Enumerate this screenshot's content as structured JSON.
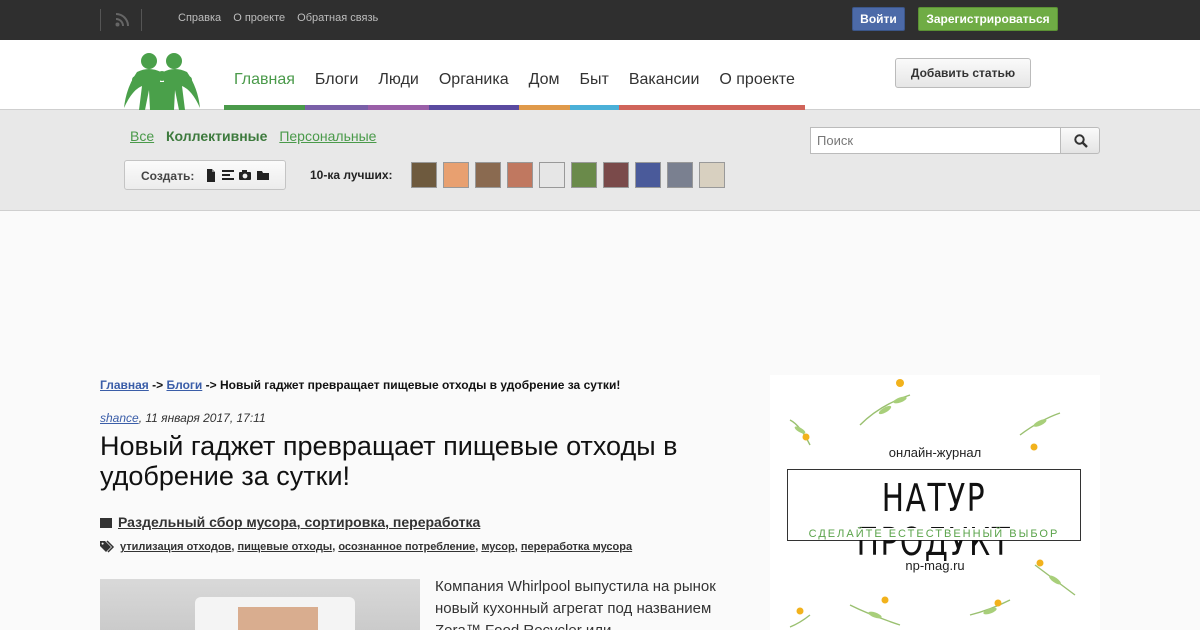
{
  "topbar": {
    "links": [
      "Справка",
      "О проекте",
      "Обратная связь"
    ],
    "login_label": "Войти",
    "register_label": "Зарегистрироваться"
  },
  "header": {
    "nav": [
      {
        "label": "Главная",
        "active": true,
        "color": "#4a9a4a"
      },
      {
        "label": "Блоги",
        "active": false,
        "color": "#7a60a8"
      },
      {
        "label": "Люди",
        "active": false,
        "color": "#9a5fa8"
      },
      {
        "label": "Органика",
        "active": false,
        "color": "#5a4aa0"
      },
      {
        "label": "Дом",
        "active": false,
        "color": "#e09a4a"
      },
      {
        "label": "Быт",
        "active": false,
        "color": "#4ab0d8"
      },
      {
        "label": "Вакансии",
        "active": false,
        "color": "#d0645a"
      },
      {
        "label": "О проекте",
        "active": false,
        "color": "#d0645a"
      }
    ],
    "add_article_label": "Добавить статью"
  },
  "subheader": {
    "tabs": [
      {
        "label": "Все",
        "current": false
      },
      {
        "label": "Коллективные",
        "current": true
      },
      {
        "label": "Персональные",
        "current": false
      }
    ],
    "search_placeholder": "Поиск",
    "create_label": "Создать:",
    "create_icons": [
      "document-icon",
      "text-lines-icon",
      "camera-icon",
      "folder-icon"
    ],
    "top10_label": "10-ка лучших:",
    "avatars": [
      {
        "color": "#6e5a3e"
      },
      {
        "color": "#e8a070"
      },
      {
        "color": "#8a6a50"
      },
      {
        "color": "#c07860"
      },
      {
        "color": "#e6e6e6"
      },
      {
        "color": "#6a8a4a"
      },
      {
        "color": "#7a4a4a"
      },
      {
        "color": "#4a5a9a"
      },
      {
        "color": "#7a8090"
      },
      {
        "color": "#d8d0c0"
      }
    ]
  },
  "breadcrumb": {
    "home": "Главная",
    "sep1": " -> ",
    "blogs": "Блоги",
    "sep2": " -> ",
    "current": "Новый гаджет превращает пищевые отходы в удобрение за сутки!"
  },
  "article": {
    "author": "shance",
    "date": ", 11 января 2017, 17:11",
    "title": "Новый гаджет превращает пищевые отходы в удобрение за сутки!",
    "blog": "Раздельный сбор мусора, сортировка, переработка",
    "tags": [
      "утилизация отходов",
      "пищевые отходы",
      "осознанное потребление",
      "мусор",
      "переработка мусора"
    ],
    "excerpt": "Компания Whirlpool выпустила на рынок новый кухонный агрегат под названием Zera™ Food Recycler или"
  },
  "ad": {
    "subtitle": "онлайн-журнал",
    "brand": "НАТУР ПРОДУКТ",
    "tagline": "СДЕЛАЙТЕ ЕСТЕСТВЕННЫЙ ВЫБОР",
    "site": "np-mag.ru"
  }
}
